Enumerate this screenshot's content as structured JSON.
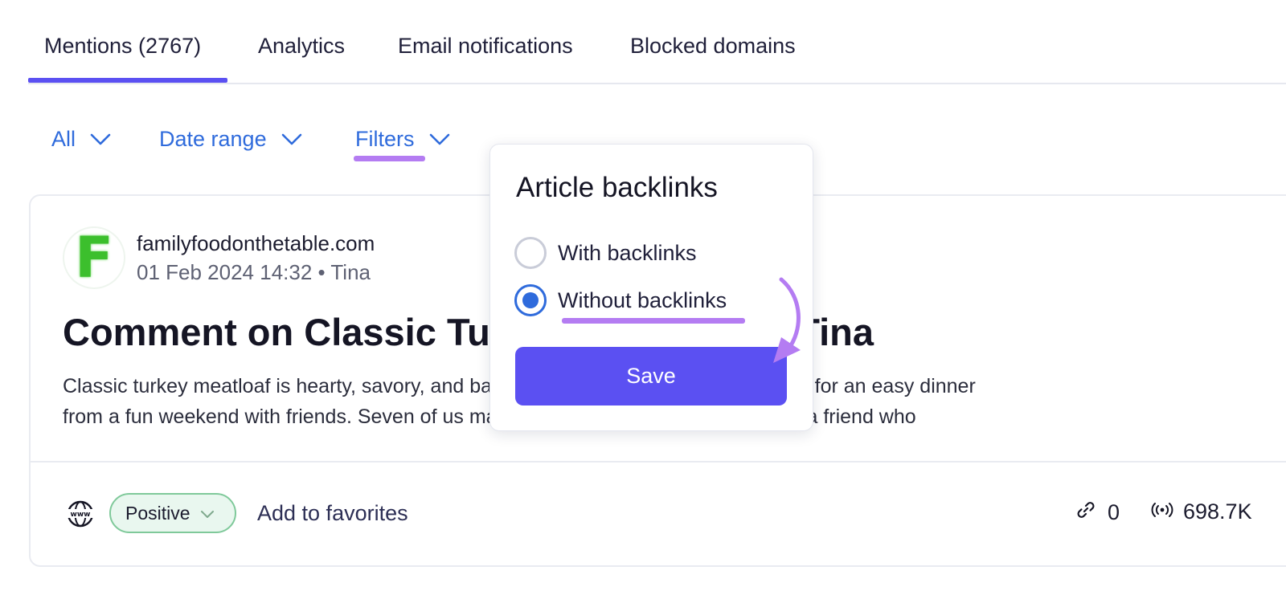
{
  "tabs": [
    {
      "label": "Mentions (2767)",
      "active": true
    },
    {
      "label": "Analytics",
      "active": false
    },
    {
      "label": "Email notifications",
      "active": false
    },
    {
      "label": "Blocked domains",
      "active": false
    }
  ],
  "filters": {
    "all_label": "All",
    "date_range_label": "Date range",
    "filters_label": "Filters"
  },
  "popover": {
    "title": "Article backlinks",
    "options": [
      {
        "label": "With backlinks",
        "selected": false
      },
      {
        "label": "Without backlinks",
        "selected": true
      }
    ],
    "save_label": "Save"
  },
  "mention": {
    "avatar_letter": "F",
    "domain": "familyfoodonthetable.com",
    "meta": "01 Feb 2024 14:32 • Tina",
    "title": "Comment on Classic Turkey Meatloaf by Tina",
    "snippet_line1": "Classic turkey meatloaf is hearty, savory, and baked until perfectly cooked and great for an easy dinner",
    "snippet_line2": "from a fun weekend with friends. Seven of us made our way to Alabama to surprise a friend who",
    "sentiment": "Positive",
    "favorites_label": "Add to favorites",
    "backlinks_count": "0",
    "reach": "698.7K"
  },
  "colors": {
    "accent": "#5b50f2",
    "link_blue": "#2f6bdc",
    "highlight_purple": "#b47cf2",
    "positive_bg": "#e9f7ef",
    "positive_border": "#7fc99a"
  },
  "icons": [
    "chevron-down-icon",
    "www-globe-icon",
    "link-icon",
    "broadcast-icon",
    "curved-arrow-annotation"
  ]
}
